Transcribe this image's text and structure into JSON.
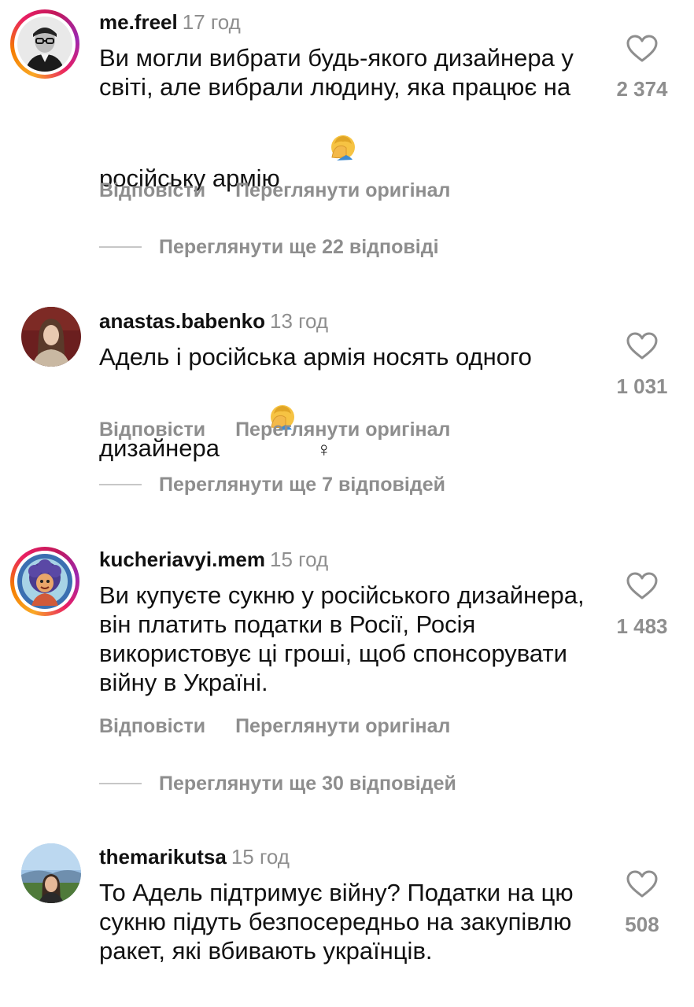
{
  "comments": [
    {
      "username": "me.freel",
      "time": "17 год",
      "text": "Ви могли вибрати будь-якого дизайнера у світі, але вибрали людину, яка працює на російську армію",
      "emoji": "face-palm",
      "likes": "2 374",
      "reply_label": "Відповісти",
      "view_original_label": "Переглянути оригінал",
      "view_replies_label": "Переглянути ще 22 відповіді",
      "avatar": "person-with-glasses-bw"
    },
    {
      "username": "anastas.babenko",
      "time": "13 год",
      "text": "Адель і російська армія носять одного дизайнера",
      "emoji": "face-palm",
      "extra_symbol": "♀",
      "likes": "1 031",
      "reply_label": "Відповісти",
      "view_original_label": "Переглянути оригінал",
      "view_replies_label": "Переглянути ще 7 відповідей",
      "avatar": "woman-portrait"
    },
    {
      "username": "kucheriavyi.mem",
      "time": "15 год",
      "text": "Ви купуєте сукню у російського дизайнера, він платить податки в Росії, Росія використовує ці гроші, щоб спонсорувати війну в Україні.",
      "likes": "1 483",
      "reply_label": "Відповісти",
      "view_original_label": "Переглянути оригінал",
      "view_replies_label": "Переглянути ще 30 відповідей",
      "avatar": "curly-hair-cartoon"
    },
    {
      "username": "themarikutsa",
      "time": "15 год",
      "text": "То Адель підтримує війну? Податки на цю сукню підуть безпосередньо на закупівлю ракет, які вбивають українців.",
      "likes": "508",
      "avatar": "woman-landscape"
    }
  ],
  "colors": {
    "text": "#111111",
    "secondary": "#8e8e8e",
    "divider": "#c7c7c7",
    "story_ring_start": "#f9a825",
    "story_ring_end": "#c2185b"
  },
  "icons": {
    "like": "heart-outline-icon",
    "emoji": "face-palm-emoji"
  }
}
